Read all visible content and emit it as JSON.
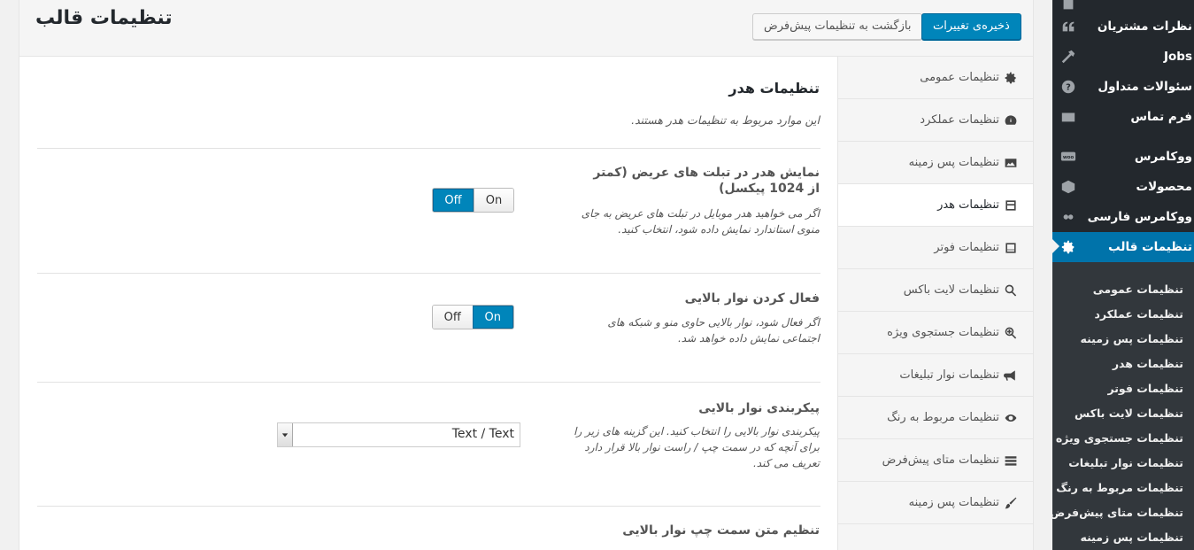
{
  "admin_menu": {
    "items": [
      {
        "label": "نظرات مشتریان",
        "icon": "quote-icon"
      },
      {
        "label": "Jobs",
        "icon": "hammer-icon"
      },
      {
        "label": "سئوالات متداول",
        "icon": "help-icon"
      },
      {
        "label": "فرم تماس",
        "icon": "mail-icon"
      },
      {
        "label": "ووکامرس",
        "icon": "woo-icon"
      },
      {
        "label": "محصولات",
        "icon": "box-icon"
      },
      {
        "label": "ووکامرس فارسی",
        "icon": "woo-persian-icon"
      },
      {
        "label": "تنظیمات قالب",
        "icon": "gear-icon"
      }
    ],
    "submenu": [
      "تنظیمات عمومی",
      "تنظیمات عملکرد",
      "تنظیمات پس زمینه",
      "تنظیمات هدر",
      "تنظیمات فوتر",
      "تنظیمات لایت باکس",
      "تنظیمات جستجوی ویژه",
      "تنظیمات نوار تبلیغات",
      "تنظیمات مربوط به رنگ",
      "تنظیمات متای پیش‌فرض",
      "تنظیمات پس زمینه"
    ]
  },
  "header": {
    "title": "تنظیمات قالب",
    "save_label": "ذخیره‌ی تغییرات",
    "reset_label": "بازگشت به تنظیمات پیش‌فرض"
  },
  "tabs": [
    {
      "label": "تنظیمات عمومی",
      "icon": "gear-icon"
    },
    {
      "label": "تنظیمات عملکرد",
      "icon": "dashboard-icon"
    },
    {
      "label": "تنظیمات پس زمینه",
      "icon": "image-icon"
    },
    {
      "label": "تنظیمات هدر",
      "icon": "header-icon",
      "active": true
    },
    {
      "label": "تنظیمات فوتر",
      "icon": "footer-icon"
    },
    {
      "label": "تنظیمات لایت باکس",
      "icon": "search-icon"
    },
    {
      "label": "تنظیمات جستجوی ویژه",
      "icon": "zoom-plus-icon"
    },
    {
      "label": "تنظیمات نوار تبلیغات",
      "icon": "megaphone-icon"
    },
    {
      "label": "تنظیمات مربوط به رنگ",
      "icon": "eye-icon"
    },
    {
      "label": "تنظیمات متای پیش‌فرض",
      "icon": "list-icon"
    },
    {
      "label": "تنظیمات پس زمینه",
      "icon": "brush-icon"
    }
  ],
  "section": {
    "title": "تنظیمات هدر",
    "description": "این موارد مربوط به تنظیمات هدر هستند."
  },
  "options": [
    {
      "title": "نمایش هدر در تبلت های عریض (کمتر از 1024 پیکسل)",
      "description": "اگر می خواهید هدر موبایل در تبلت های عریض به جای منوی استاندارد نمایش داده شود، انتخاب کنید.",
      "off_label": "Off",
      "on_label": "On",
      "value": "Off"
    },
    {
      "title": "فعال کردن نوار بالایی",
      "description": "اگر فعال شود، نوار بالایی حاوی منو و شبکه های اجتماعی نمایش داده خواهد شد.",
      "off_label": "Off",
      "on_label": "On",
      "value": "On"
    },
    {
      "title": "پیکربندی نوار بالایی",
      "description": "پیکربندی نوار بالایی را انتخاب کنید. این گزینه های زیر را برای آنچه که در سمت چپ / راست نوار بالا قرار دارد تعریف می کند.",
      "select_value": "Text / Text"
    },
    {
      "title": "تنظیم متن سمت چپ نوار بالایی"
    }
  ],
  "colors": {
    "sidebar_bg": "#23282d",
    "submenu_bg": "#32373c",
    "accent": "#0085ba"
  }
}
